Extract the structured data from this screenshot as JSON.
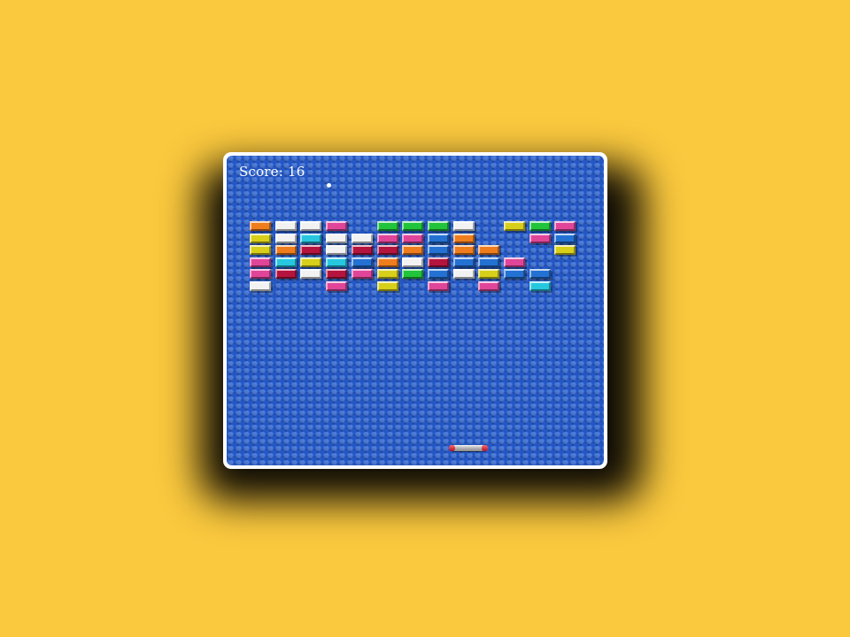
{
  "game": {
    "score_label": "Score: 16"
  },
  "palette": {
    "orange": "#ef7d1e",
    "white": "#f2f2f2",
    "magenta": "#e0459a",
    "green": "#21c43a",
    "yellow": "#d7cf1a",
    "cyan": "#27c7df",
    "crimson": "#b5143e",
    "blue": "#2471d4"
  },
  "bricks": [
    [
      "orange",
      "white",
      "white",
      "magenta",
      null,
      "green",
      "green",
      "green",
      "white",
      null,
      "yellow",
      "green",
      "magenta"
    ],
    [
      "yellow",
      "white",
      "cyan",
      "white",
      "white",
      "magenta",
      "magenta",
      "blue",
      "orange",
      null,
      null,
      "magenta",
      "blue"
    ],
    [
      "yellow",
      "orange",
      "crimson",
      "white",
      "crimson",
      "crimson",
      "orange",
      "blue",
      "orange",
      "orange",
      null,
      null,
      "yellow"
    ],
    [
      "magenta",
      "cyan",
      "yellow",
      "cyan",
      "blue",
      "orange",
      "white",
      "crimson",
      "blue",
      "blue",
      "magenta",
      null,
      null
    ],
    [
      "magenta",
      "crimson",
      "white",
      "crimson",
      "magenta",
      "yellow",
      "green",
      "blue",
      "white",
      "yellow",
      "blue",
      "blue",
      null
    ],
    [
      "white",
      null,
      null,
      "magenta",
      null,
      "yellow",
      null,
      "magenta",
      null,
      "magenta",
      null,
      "cyan",
      null
    ]
  ]
}
